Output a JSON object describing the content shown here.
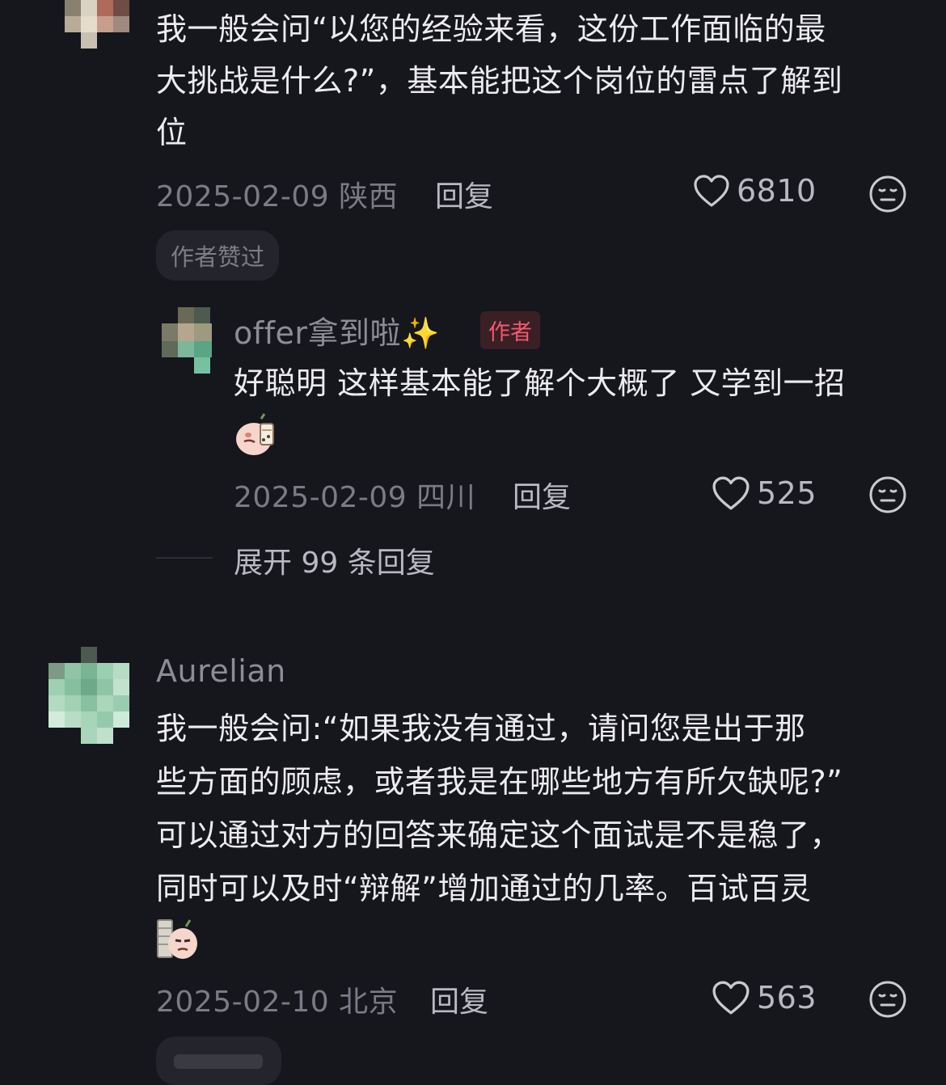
{
  "comments": [
    {
      "text_lines": [
        "我一般会问“以您的经验来看，这份工作面临的最",
        "大挑战是什么?”，基本能把这个岗位的雷点了解到",
        "位"
      ],
      "date": "2025-02-09 陕西",
      "reply_label": "回复",
      "likes": "6810",
      "badge": "作者赞过",
      "replies": [
        {
          "username": "offer拿到啦✨",
          "author_tag": "作者",
          "text": "好聪明 这样基本能了解个大概了 又学到一招",
          "date": "2025-02-09 四川",
          "reply_label": "回复",
          "likes": "525"
        }
      ],
      "expand_label": "展开 99 条回复"
    },
    {
      "username": "Aurelian",
      "text_lines": [
        "我一般会问:“如果我没有通过，请问您是出于那",
        "些方面的顾虑，或者我是在哪些地方有所欠缺呢?”",
        "可以通过对方的回答来确定这个面试是不是稳了，",
        "同时可以及时“辩解”增加通过的几率。百试百灵"
      ],
      "date": "2025-02-10 北京",
      "reply_label": "回复",
      "likes": "563"
    }
  ],
  "icons": {
    "like": "heart-outline-icon",
    "dislike": "meh-face-icon"
  },
  "colors": {
    "background": "#16161d",
    "text": "#ececef",
    "muted": "#7b7b85",
    "author_badge": "#f2596d"
  }
}
